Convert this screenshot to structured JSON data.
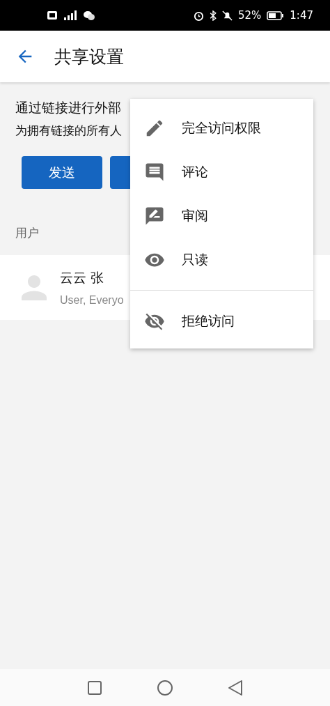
{
  "status_bar": {
    "battery": "52%",
    "time": "1:47"
  },
  "header": {
    "title": "共享设置"
  },
  "link_section": {
    "title": "通过链接进行外部",
    "subtitle": "为拥有链接的所有人",
    "buttons": [
      {
        "kind": "labeled",
        "label": "发送"
      },
      {
        "kind": "covered"
      }
    ]
  },
  "users_label": "用户",
  "users": [
    {
      "name": "云云 张",
      "role": "User, Everyo"
    }
  ],
  "menu": {
    "groups": [
      [
        {
          "label": "完全访问权限"
        },
        {
          "label": "评论"
        },
        {
          "label": "审阅"
        },
        {
          "label": "只读"
        }
      ],
      [
        {
          "label": "拒绝访问"
        }
      ]
    ]
  }
}
